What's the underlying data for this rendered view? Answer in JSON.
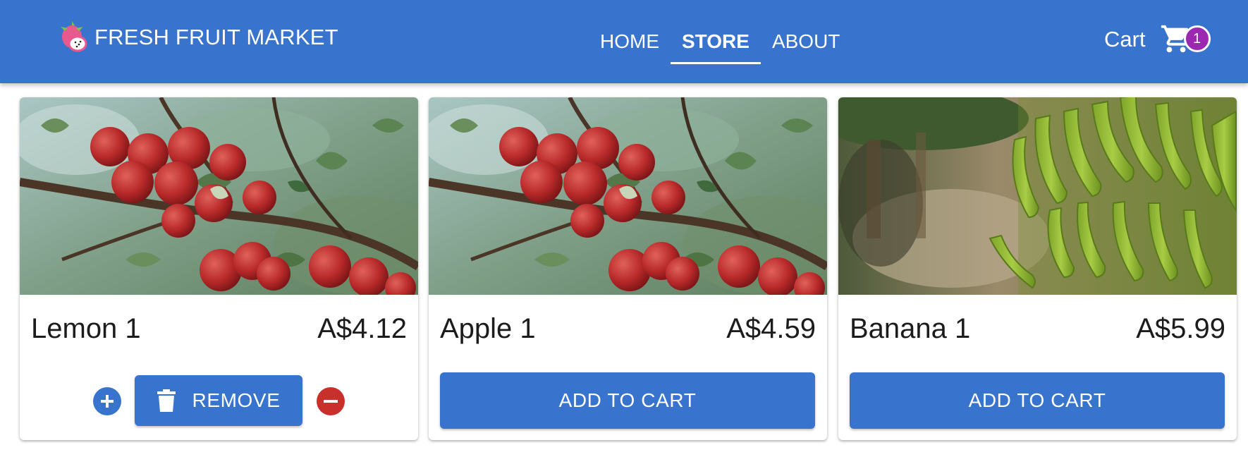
{
  "app": {
    "title": "FRESH FRUIT MARKET",
    "logo_icon": "dragonfruit-icon"
  },
  "nav": {
    "links": [
      {
        "label": "HOME",
        "active": false
      },
      {
        "label": "STORE",
        "active": true
      },
      {
        "label": "ABOUT",
        "active": false
      }
    ]
  },
  "cart": {
    "label": "Cart",
    "icon": "shopping-cart-icon",
    "count": "1"
  },
  "products": [
    {
      "name": "Lemon 1",
      "price": "A$4.12",
      "image": "apple-tree-photo",
      "in_cart": true,
      "remove_label": "REMOVE",
      "increase_icon": "plus-circle-icon",
      "decrease_icon": "minus-circle-icon",
      "remove_icon": "trash-icon"
    },
    {
      "name": "Apple 1",
      "price": "A$4.59",
      "image": "apple-tree-photo",
      "in_cart": false,
      "add_label": "ADD TO CART"
    },
    {
      "name": "Banana 1",
      "price": "A$5.99",
      "image": "banana-bunch-photo",
      "in_cart": false,
      "add_label": "ADD TO CART"
    }
  ],
  "colors": {
    "primary": "#3873cd",
    "badge": "#9c27b0",
    "danger": "#c9302c",
    "text": "#1c1c1c"
  }
}
